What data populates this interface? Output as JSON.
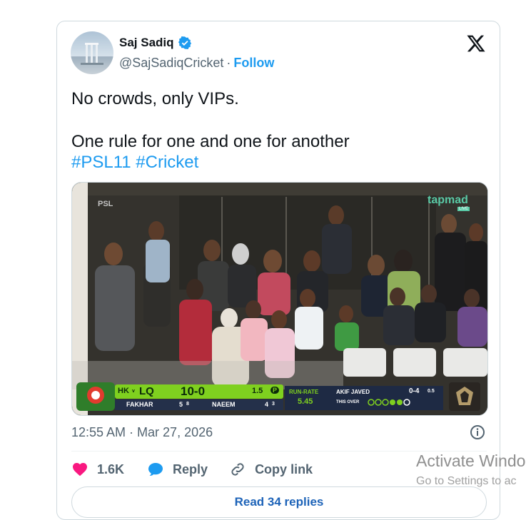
{
  "tweet": {
    "author": {
      "display_name": "Saj Sadiq",
      "handle": "@SajSadiqCricket",
      "separator": "·",
      "follow_label": "Follow"
    },
    "text_line1": "No crowds, only VIPs.",
    "text_line2": "One rule for one and one for another",
    "hashtags": [
      "#PSL11",
      "#Cricket"
    ],
    "timestamp": "12:55 AM · Mar 27, 2026",
    "likes_count": "1.6K",
    "reply_label": "Reply",
    "copy_link_label": "Copy link",
    "read_replies_label": "Read 34 replies"
  },
  "media": {
    "broadcaster": "tapmad",
    "broadcaster_sub": "LIVE",
    "league_logo": "PSL",
    "scorebar": {
      "teams": "HK",
      "vs": "v",
      "batting_team": "LQ",
      "score": "10-0",
      "overs": "1.5",
      "powerplay": "P",
      "batter1": "FAKHAR",
      "batter1_score": "5",
      "batter1_balls": "8",
      "batter2": "NAEEM",
      "batter2_score": "4",
      "batter2_balls": "3",
      "run_rate_label": "RUN-RATE",
      "run_rate": "5.45",
      "bowler": "AKIF JAVED",
      "bowler_figures": "0-4",
      "bowler_overs": "0.5",
      "this_over_label": "THIS OVER"
    }
  },
  "os_watermark": {
    "title": "Activate Windo",
    "subtitle": "Go to Settings to ac"
  },
  "colors": {
    "accent": "#1d9bf0",
    "heart": "#f91880",
    "score_green": "#7fd01f"
  },
  "icons": [
    "verified-badge-icon",
    "x-logo-icon",
    "info-icon",
    "heart-icon",
    "reply-bubble-icon",
    "link-icon"
  ]
}
